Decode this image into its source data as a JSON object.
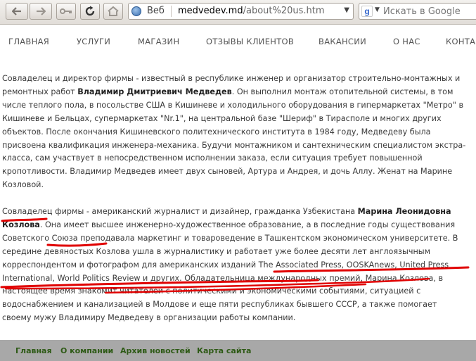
{
  "browser": {
    "back_icon": "back-arrow-icon",
    "forward_icon": "forward-arrow-icon",
    "key_icon": "key-icon",
    "reload_icon": "reload-icon",
    "home_icon": "home-icon",
    "url_zone": "Веб",
    "url_host": "medvedev.md",
    "url_path": "/about%20us.htm",
    "search_placeholder": "Искать в Google"
  },
  "nav": {
    "items": [
      "ГЛАВНАЯ",
      "УСЛУГИ",
      "МАГАЗИН",
      "ОТЗЫВЫ КЛИЕНТОВ",
      "ВАКАНСИИ",
      "О НАС",
      "КОНТАКТЫ"
    ]
  },
  "content": {
    "p1": {
      "t1": "Совладелец и директор фирмы - известный в республике инженер и организатор строительно-монтажных и ремонтных работ ",
      "name": "Владимир Дмитриевич Медведев",
      "t2": ". Он выполнил монтаж отопительной системы, в том числе теплого пола, в посольстве США в Кишиневе и холодильного оборудования в гипермаркетах \"Метро\" в Кишиневе и Бельцах, супермаркетах \"Nr.1\", на центральной базе \"Шериф\" в Тирасполе и многих других объектов. После окончания Кишиневского политехнического института в 1984 году, Медведеву была присвоена квалификация инженера-механика. Будучи монтажником и сантехническим специалистом экстра-класса, сам участвует в непосредственном исполнении заказа, если ситуация требует повышенной кропотливости. Владимир Медведев имеет двух сыновей, Артура и Андрея, и дочь Аллу. Женат на Марине Козловой."
    },
    "p2": {
      "t1": "Совладелец фирмы - американский журналист и дизайнер, гражданка Узбекистана ",
      "name": "Марина Леонидовна Козлова",
      "t2": ". Она имеет высшее инженерно-художественное образование, а в последние годы существования Советского Союза преподавала маркетинг и товароведение в Ташкентском экономическом университете. В середине девяностых Козлова ушла в журналистику и работает уже более десяти лет англоязычным корреспондентом и фотографом для американских изданий The Associated Press, OOSKAnews, United Press International, World Politics Review и других. Обладательница международных премий, Марина Козлова, в настоящее время знакомит читателей с политическими и экономическими событиями, ситуацией с водоснабжением и канализацией в Молдове и еще пяти республиках бывшего СССР, а также помогает своему мужу Владимиру Медведеву в организации работы компании."
    }
  },
  "annotations": {
    "color": "#e00000",
    "count": 6
  },
  "footer": {
    "links": [
      "Главная",
      "О компании",
      "Архив новостей",
      "Карта сайта"
    ],
    "link_color": "#2e5a16"
  }
}
